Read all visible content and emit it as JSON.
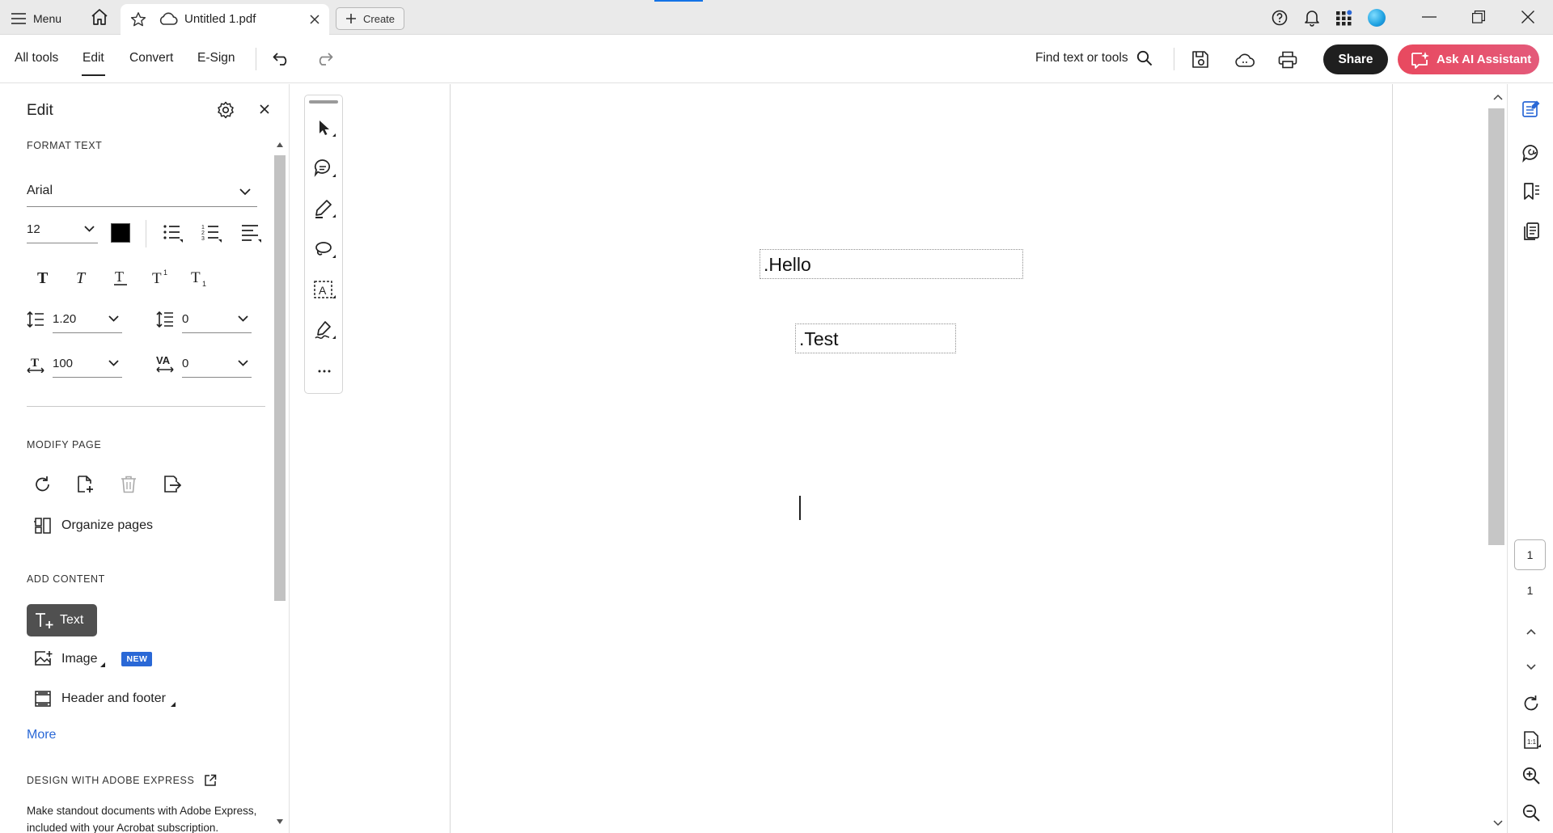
{
  "titlebar": {
    "menu_label": "Menu",
    "tab_title": "Untitled 1.pdf",
    "create_label": "Create"
  },
  "toolbar": {
    "tabs": [
      {
        "label": "All tools"
      },
      {
        "label": "Edit",
        "active": true
      },
      {
        "label": "Convert"
      },
      {
        "label": "E-Sign"
      }
    ],
    "find_label": "Find text or tools",
    "share_label": "Share",
    "ai_label": "Ask AI Assistant"
  },
  "left_panel": {
    "title": "Edit",
    "format_text": {
      "heading": "FORMAT TEXT",
      "font": "Arial",
      "font_size": "12",
      "text_color": "#000000",
      "line_spacing": "1.20",
      "paragraph_spacing": "0",
      "horizontal_scale": "100",
      "character_spacing": "0"
    },
    "modify_page": {
      "heading": "MODIFY PAGE",
      "organize_label": "Organize pages"
    },
    "add_content": {
      "heading": "ADD CONTENT",
      "text_label": "Text",
      "image_label": "Image",
      "new_badge": "NEW",
      "header_footer_label": "Header and footer",
      "more_label": "More"
    },
    "design": {
      "heading": "DESIGN WITH ADOBE EXPRESS",
      "description": "Make standout documents with Adobe Express, included with your Acrobat subscription."
    }
  },
  "document": {
    "textboxes": [
      {
        "text": ".Hello"
      },
      {
        "text": ".Test"
      }
    ]
  },
  "page_nav": {
    "current": "1",
    "total": "1"
  },
  "colors": {
    "ai_button": "#e8495f",
    "share_button": "#1f1f1f",
    "link": "#2a68d6",
    "new_badge": "#2a68d6"
  }
}
